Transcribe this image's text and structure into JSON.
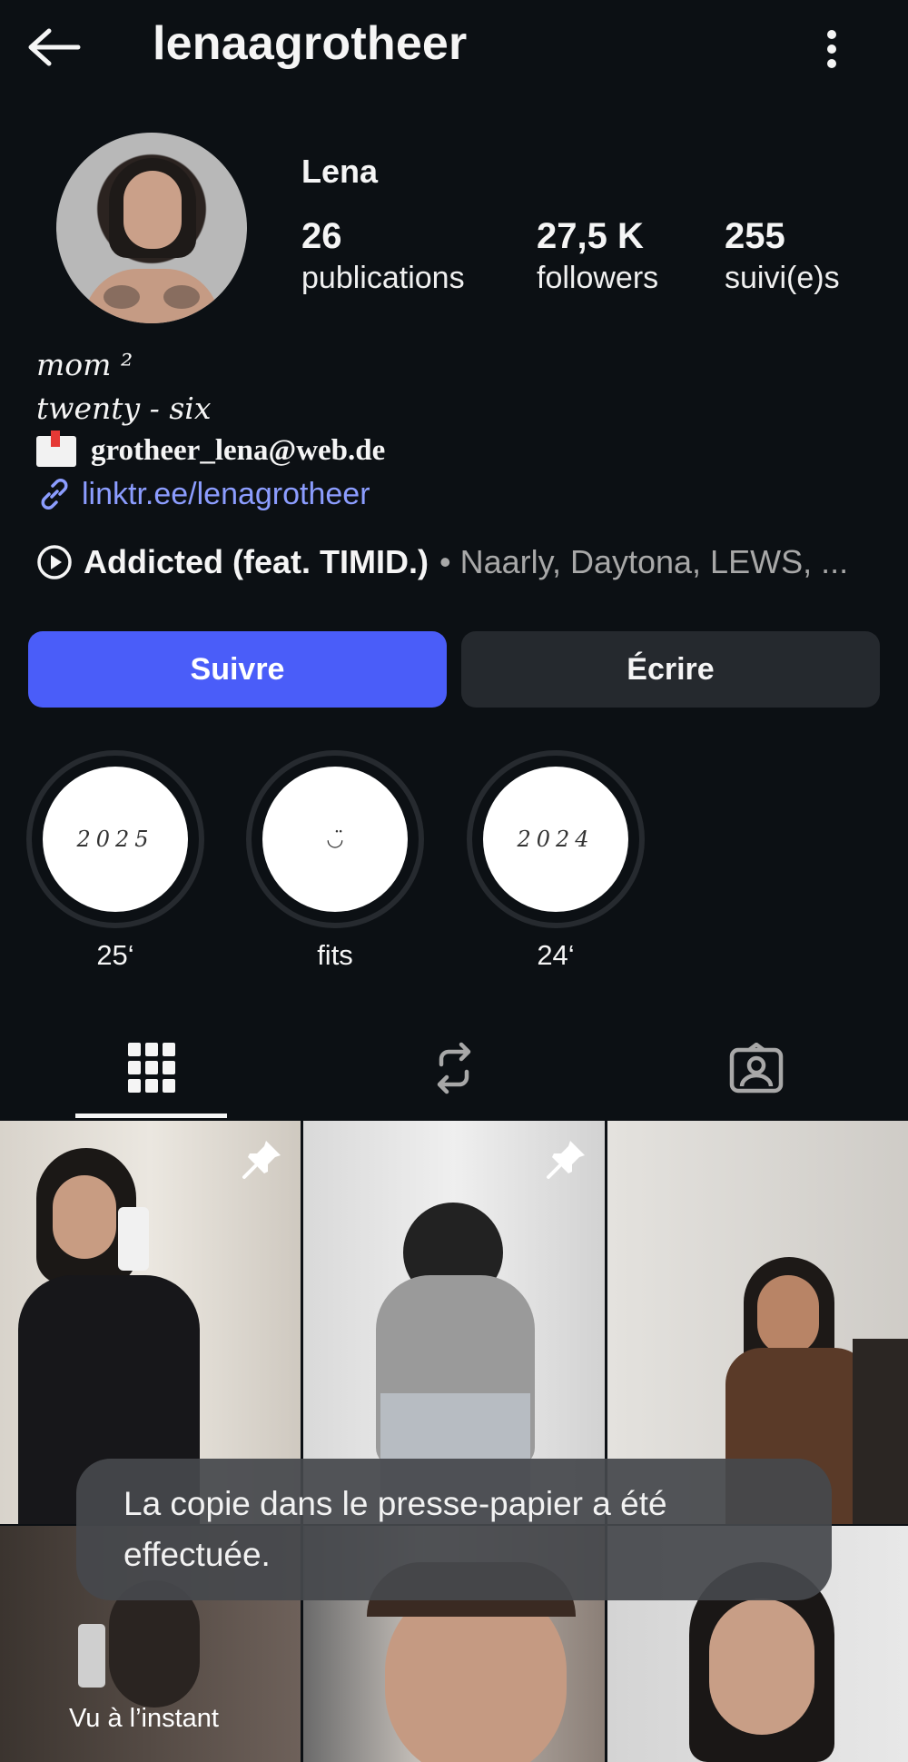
{
  "topbar": {
    "username": "lenaagrotheer",
    "back_icon": "arrow-left-icon",
    "menu_icon": "more-vertical-icon"
  },
  "profile": {
    "display_name": "Lena",
    "stats": [
      {
        "value": "26",
        "label": "publications"
      },
      {
        "value": "27,5 K",
        "label": "followers"
      },
      {
        "value": "255",
        "label": "suivi(e)s"
      }
    ],
    "bio_lines": [
      "mom ²",
      "twenty - six"
    ],
    "email": "grotheer_lena@web.de",
    "link": "linktr.ee/lenagrotheer"
  },
  "music": {
    "track": "Addicted (feat. TIMID.)",
    "artists": "• Naarly, Daytona, LEWS, ..."
  },
  "actions": {
    "follow_label": "Suivre",
    "message_label": "Écrire"
  },
  "highlights": [
    {
      "cover_text": "2025",
      "label": "25‘"
    },
    {
      "cover_text": "◡̈",
      "label": "fits"
    },
    {
      "cover_text": "2024",
      "label": "24‘"
    }
  ],
  "tabs": [
    "grid-icon",
    "reels-icon",
    "tagged-icon"
  ],
  "grid": {
    "seen_label": "Vu à l’instant"
  },
  "toast": {
    "message": "La copie dans le presse-papier a été effectuée."
  },
  "colors": {
    "background": "#0c1014",
    "accent": "#4a5df9",
    "link": "#8c9dff",
    "secondary_button": "#25292e"
  }
}
